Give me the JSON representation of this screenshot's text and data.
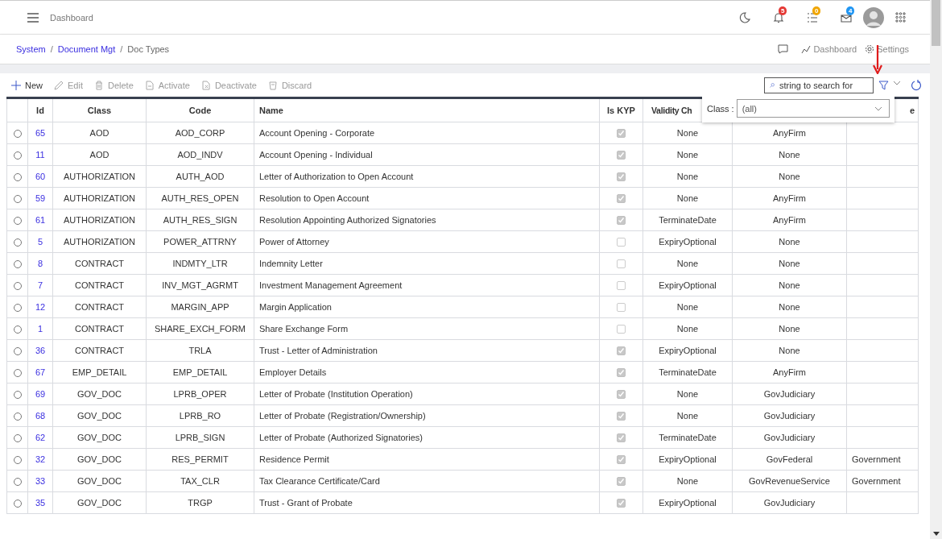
{
  "header": {
    "title": "Dashboard",
    "notifications": [
      {
        "kind": "bell",
        "count": "5",
        "color": "#e53935"
      },
      {
        "kind": "tasks",
        "count": "0",
        "color": "#f0a500"
      },
      {
        "kind": "mail",
        "count": "4",
        "color": "#2196f3"
      }
    ]
  },
  "breadcrumb": {
    "items": [
      {
        "label": "System",
        "link": true
      },
      {
        "label": "Document Mgt",
        "link": true
      },
      {
        "label": "Doc Types",
        "link": false
      }
    ],
    "separator": "/",
    "actions": [
      {
        "kind": "comment"
      },
      {
        "kind": "chart",
        "label": "Dashboard"
      },
      {
        "kind": "gear",
        "label": "Settings"
      }
    ]
  },
  "toolbar": {
    "buttons": [
      {
        "kind": "plus",
        "label": "New",
        "disabled": false
      },
      {
        "kind": "pencil",
        "label": "Edit",
        "disabled": true
      },
      {
        "kind": "trash",
        "label": "Delete",
        "disabled": true
      },
      {
        "kind": "doc",
        "label": "Activate",
        "disabled": true
      },
      {
        "kind": "docx",
        "label": "Deactivate",
        "disabled": true
      },
      {
        "kind": "undo",
        "label": "Discard",
        "disabled": true
      }
    ],
    "search": {
      "placeholder": "string to search for"
    }
  },
  "filter_popup": {
    "label": "Class :",
    "value": "(all)"
  },
  "table": {
    "columns": [
      "Id",
      "Class",
      "Code",
      "Name",
      "Is KYP",
      "Validity Ch",
      "",
      "e"
    ],
    "rows": [
      {
        "selected": false,
        "id": "65",
        "class": "AOD",
        "code": "AOD_CORP",
        "name": "Account Opening - Corporate",
        "kyp": true,
        "validity": "None",
        "column_7": "AnyFirm",
        "column_8": ""
      },
      {
        "selected": false,
        "id": "11",
        "class": "AOD",
        "code": "AOD_INDV",
        "name": "Account Opening - Individual",
        "kyp": true,
        "validity": "None",
        "column_7": "None",
        "column_8": ""
      },
      {
        "selected": false,
        "id": "60",
        "class": "AUTHORIZATION",
        "code": "AUTH_AOD",
        "name": "Letter of Authorization to Open Account",
        "kyp": true,
        "validity": "None",
        "column_7": "None",
        "column_8": ""
      },
      {
        "selected": false,
        "id": "59",
        "class": "AUTHORIZATION",
        "code": "AUTH_RES_OPEN",
        "name": "Resolution to Open Account",
        "kyp": true,
        "validity": "None",
        "column_7": "AnyFirm",
        "column_8": ""
      },
      {
        "selected": false,
        "id": "61",
        "class": "AUTHORIZATION",
        "code": "AUTH_RES_SIGN",
        "name": "Resolution Appointing Authorized Signatories",
        "kyp": true,
        "validity": "TerminateDate",
        "column_7": "AnyFirm",
        "column_8": ""
      },
      {
        "selected": false,
        "id": "5",
        "class": "AUTHORIZATION",
        "code": "POWER_ATTRNY",
        "name": "Power of Attorney",
        "kyp": false,
        "validity": "ExpiryOptional",
        "column_7": "None",
        "column_8": ""
      },
      {
        "selected": false,
        "id": "8",
        "class": "CONTRACT",
        "code": "INDMTY_LTR",
        "name": "Indemnity Letter",
        "kyp": false,
        "validity": "None",
        "column_7": "None",
        "column_8": ""
      },
      {
        "selected": false,
        "id": "7",
        "class": "CONTRACT",
        "code": "INV_MGT_AGRMT",
        "name": "Investment Management Agreement",
        "kyp": false,
        "validity": "ExpiryOptional",
        "column_7": "None",
        "column_8": ""
      },
      {
        "selected": false,
        "id": "12",
        "class": "CONTRACT",
        "code": "MARGIN_APP",
        "name": "Margin Application",
        "kyp": false,
        "validity": "None",
        "column_7": "None",
        "column_8": ""
      },
      {
        "selected": false,
        "id": "1",
        "class": "CONTRACT",
        "code": "SHARE_EXCH_FORM",
        "name": "Share Exchange Form",
        "kyp": false,
        "validity": "None",
        "column_7": "None",
        "column_8": ""
      },
      {
        "selected": false,
        "id": "36",
        "class": "CONTRACT",
        "code": "TRLA",
        "name": "Trust - Letter of Administration",
        "kyp": true,
        "validity": "ExpiryOptional",
        "column_7": "None",
        "column_8": ""
      },
      {
        "selected": false,
        "id": "67",
        "class": "EMP_DETAIL",
        "code": "EMP_DETAIL",
        "name": "Employer Details",
        "kyp": true,
        "validity": "TerminateDate",
        "column_7": "AnyFirm",
        "column_8": ""
      },
      {
        "selected": false,
        "id": "69",
        "class": "GOV_DOC",
        "code": "LPRB_OPER",
        "name": "Letter of Probate (Institution Operation)",
        "kyp": true,
        "validity": "None",
        "column_7": "GovJudiciary",
        "column_8": ""
      },
      {
        "selected": false,
        "id": "68",
        "class": "GOV_DOC",
        "code": "LPRB_RO",
        "name": "Letter of Probate (Registration/Ownership)",
        "kyp": true,
        "validity": "None",
        "column_7": "GovJudiciary",
        "column_8": ""
      },
      {
        "selected": false,
        "id": "62",
        "class": "GOV_DOC",
        "code": "LPRB_SIGN",
        "name": "Letter of Probate (Authorized Signatories)",
        "kyp": true,
        "validity": "TerminateDate",
        "column_7": "GovJudiciary",
        "column_8": ""
      },
      {
        "selected": false,
        "id": "32",
        "class": "GOV_DOC",
        "code": "RES_PERMIT",
        "name": "Residence Permit",
        "kyp": true,
        "validity": "ExpiryOptional",
        "column_7": "GovFederal",
        "column_8": "Government"
      },
      {
        "selected": false,
        "id": "33",
        "class": "GOV_DOC",
        "code": "TAX_CLR",
        "name": "Tax Clearance Certificate/Card",
        "kyp": true,
        "validity": "None",
        "column_7": "GovRevenueService",
        "column_8": "Government"
      },
      {
        "selected": false,
        "id": "35",
        "class": "GOV_DOC",
        "code": "TRGP",
        "name": "Trust - Grant of Probate",
        "kyp": true,
        "validity": "ExpiryOptional",
        "column_7": "GovJudiciary",
        "column_8": ""
      }
    ]
  }
}
